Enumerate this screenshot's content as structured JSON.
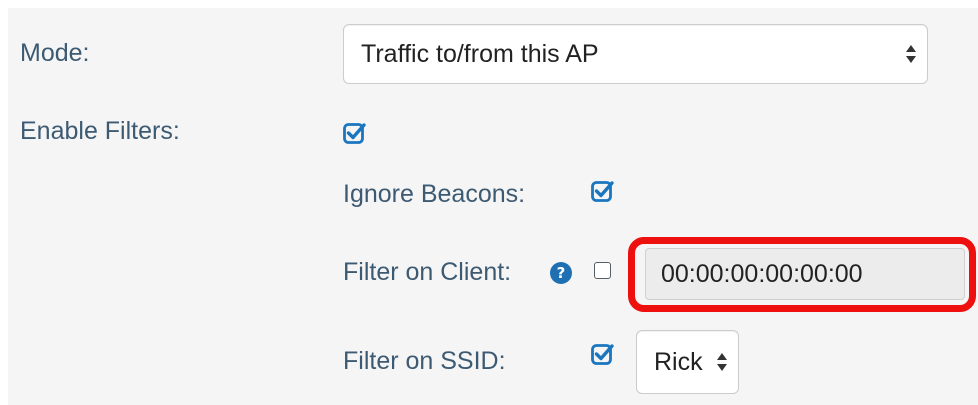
{
  "mode": {
    "label": "Mode:",
    "selected": "Traffic to/from this AP"
  },
  "enable_filters": {
    "label": "Enable Filters:",
    "checked": true
  },
  "ignore_beacons": {
    "label": "Ignore Beacons:",
    "checked": true
  },
  "filter_client": {
    "label": "Filter on Client:",
    "help_icon": "?",
    "checked": false,
    "value": "00:00:00:00:00:00"
  },
  "filter_ssid": {
    "label": "Filter on SSID:",
    "checked": true,
    "selected": "Rick"
  },
  "colors": {
    "label_text": "#3d5a73",
    "checkbox_accent": "#1b76c0",
    "help_icon": "#1f6fb3",
    "highlight": "#ee0f0f",
    "panel_background": "#f5f5f5"
  }
}
